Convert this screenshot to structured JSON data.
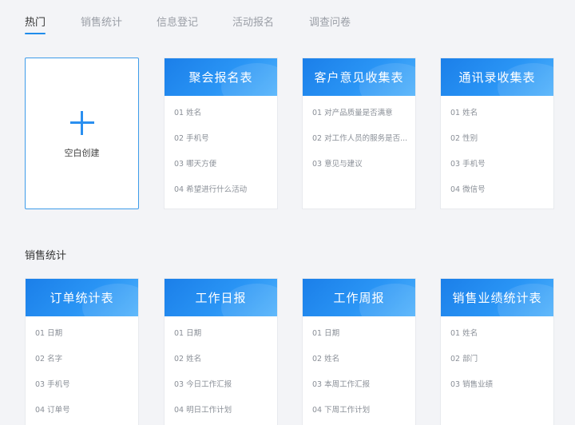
{
  "tabs": [
    {
      "label": "热门",
      "active": true
    },
    {
      "label": "销售统计",
      "active": false
    },
    {
      "label": "信息登记",
      "active": false
    },
    {
      "label": "活动报名",
      "active": false
    },
    {
      "label": "调查问卷",
      "active": false
    }
  ],
  "accent_color": "#1f8ceb",
  "blank_card": {
    "label": "空白创建",
    "icon": "plus-icon"
  },
  "hot_templates": [
    {
      "title": "聚会报名表",
      "fields": [
        "01 姓名",
        "02 手机号",
        "03 哪天方便",
        "04 希望进行什么活动"
      ]
    },
    {
      "title": "客户意见收集表",
      "fields": [
        "01 对产品质量是否满意",
        "02 对工作人员的服务是否...",
        "03 意见与建议"
      ]
    },
    {
      "title": "通讯录收集表",
      "fields": [
        "01 姓名",
        "02 性别",
        "03 手机号",
        "04 微信号"
      ]
    }
  ],
  "section_title": "销售统计",
  "sales_templates": [
    {
      "title": "订单统计表",
      "fields": [
        "01 日期",
        "02 名字",
        "03 手机号",
        "04 订单号"
      ]
    },
    {
      "title": "工作日报",
      "fields": [
        "01 日期",
        "02 姓名",
        "03 今日工作汇报",
        "04 明日工作计划"
      ]
    },
    {
      "title": "工作周报",
      "fields": [
        "01 日期",
        "02 姓名",
        "03 本周工作汇报",
        "04 下周工作计划"
      ]
    },
    {
      "title": "销售业绩统计表",
      "fields": [
        "01 姓名",
        "02 部门",
        "03 销售业绩"
      ]
    }
  ]
}
